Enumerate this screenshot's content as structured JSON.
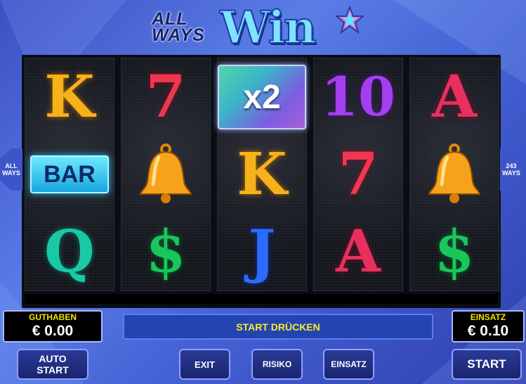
{
  "game": {
    "logo_line1": "ALL",
    "logo_line2": "WAYS",
    "logo_word": "Win"
  },
  "ways_left": {
    "line1": "ALL",
    "line2": "WAYS"
  },
  "ways_right": {
    "line1": "243",
    "line2": "WAYS"
  },
  "reels": [
    [
      "K",
      "BAR",
      "Q"
    ],
    [
      "7",
      "bell",
      "$"
    ],
    [
      "x2",
      "K",
      "J"
    ],
    [
      "10",
      "7",
      "A"
    ],
    [
      "A",
      "bell",
      "$"
    ]
  ],
  "multiplier_label": "x2",
  "bar_label": "BAR",
  "balance": {
    "label": "GUTHABEN",
    "value": "€ 0.00"
  },
  "bet": {
    "label": "EINSATZ",
    "value": "€ 0.10"
  },
  "status_message": "START DRÜCKEN",
  "buttons": {
    "auto_start": "AUTO START",
    "exit": "EXIT",
    "risiko": "RISIKO",
    "einsatz": "EINSATZ",
    "start": "START"
  },
  "colors": {
    "K": "#f6b21a",
    "Q": "#19c9a6",
    "J": "#2a6cff",
    "A": "#e8305e",
    "7": "#f0374f",
    "10": "#a43ff0",
    "dollar": "#19c65a",
    "bell": "#f0a51f"
  }
}
